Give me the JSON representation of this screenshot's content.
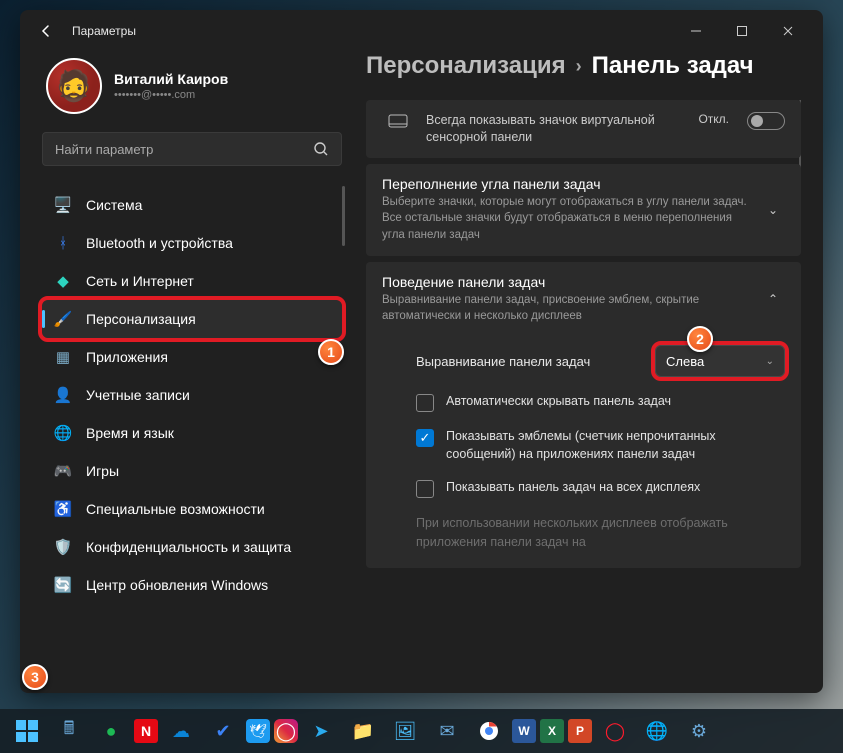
{
  "window": {
    "title": "Параметры"
  },
  "user": {
    "name": "Виталий Каиров",
    "email": "•••••••@•••••.com"
  },
  "search": {
    "placeholder": "Найти параметр"
  },
  "sidebar": {
    "items": [
      {
        "icon": "system-icon",
        "label": "Система"
      },
      {
        "icon": "bluetooth-icon",
        "label": "Bluetooth и устройства"
      },
      {
        "icon": "network-icon",
        "label": "Сеть и Интернет"
      },
      {
        "icon": "personalization-icon",
        "label": "Персонализация",
        "active": true
      },
      {
        "icon": "apps-icon",
        "label": "Приложения"
      },
      {
        "icon": "accounts-icon",
        "label": "Учетные записи"
      },
      {
        "icon": "time-lang-icon",
        "label": "Время и язык"
      },
      {
        "icon": "gaming-icon",
        "label": "Игры"
      },
      {
        "icon": "accessibility-icon",
        "label": "Специальные возможности"
      },
      {
        "icon": "privacy-icon",
        "label": "Конфиденциальность и защита"
      },
      {
        "icon": "update-icon",
        "label": "Центр обновления Windows"
      }
    ]
  },
  "breadcrumb": {
    "parent": "Персонализация",
    "current": "Панель задач"
  },
  "cards": {
    "touchpad": {
      "title": "Всегда показывать значок виртуальной сенсорной панели",
      "state": "Откл."
    },
    "overflow": {
      "title": "Переполнение угла панели задач",
      "desc": "Выберите значки, которые могут отображаться в углу панели задач. Все остальные значки будут отображаться в меню переполнения угла панели задач"
    },
    "behavior": {
      "title": "Поведение панели задач",
      "desc": "Выравнивание панели задач, присвоение эмблем, скрытие автоматически и несколько дисплеев"
    }
  },
  "options": {
    "alignment_label": "Выравнивание панели задач",
    "alignment_value": "Слева",
    "auto_hide": "Автоматически скрывать панель задач",
    "show_badges": "Показывать эмблемы (счетчик непрочитанных сообщений) на приложениях панели задач",
    "all_displays": "Показывать панель задач на всех дисплеях",
    "disabled_note": "При использовании нескольких дисплеев отображать приложения панели задач на"
  },
  "badges": {
    "b1": "1",
    "b2": "2",
    "b3": "3"
  },
  "nav_icons": {
    "system": "🖥️",
    "bluetooth": "ᚼ",
    "network": "◆",
    "personalization": "🖌️",
    "apps": "▦",
    "accounts": "👤",
    "timelang": "🌐",
    "gaming": "🎮",
    "accessibility": "♿",
    "privacy": "🛡️",
    "update": "🔄"
  },
  "taskbar_icons": [
    "calc",
    "spotify",
    "netflix",
    "onedrive",
    "todo",
    "twitter",
    "instagram",
    "telegram",
    "explorer",
    "photos",
    "mail",
    "chrome",
    "word",
    "excel",
    "ppt",
    "opera",
    "edge",
    "settings"
  ]
}
